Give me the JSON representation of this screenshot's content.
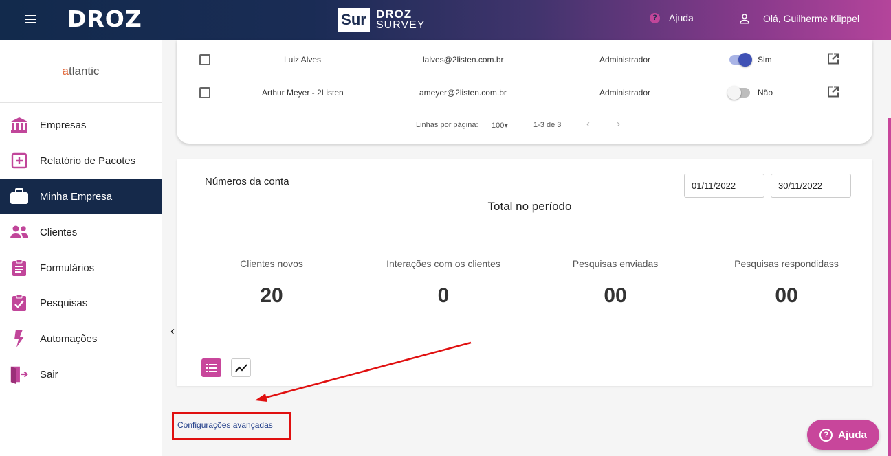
{
  "header": {
    "brand": "DROZ",
    "product_badge": "Sur",
    "product_line1": "DROZ",
    "product_line2": "SURVEY",
    "help_label": "Ajuda",
    "help_glyph": "?",
    "user_greeting": "Olá, Guilherme Klippel"
  },
  "sidebar": {
    "org_prefix": "a",
    "org_rest": "tlantic",
    "items": [
      {
        "label": "Empresas",
        "icon": "bank-icon"
      },
      {
        "label": "Relatório de Pacotes",
        "icon": "plus-box-icon"
      },
      {
        "label": "Minha Empresa",
        "icon": "briefcase-icon",
        "active": true
      },
      {
        "label": "Clientes",
        "icon": "users-icon"
      },
      {
        "label": "Formulários",
        "icon": "clipboard-list-icon"
      },
      {
        "label": "Pesquisas",
        "icon": "clipboard-check-icon"
      },
      {
        "label": "Automações",
        "icon": "lightning-icon"
      },
      {
        "label": "Sair",
        "icon": "exit-door-icon"
      }
    ]
  },
  "users_table": {
    "rows": [
      {
        "name": "Luiz Alves",
        "email": "lalves@2listen.com.br",
        "role": "Administrador",
        "active": true,
        "active_label": "Sim"
      },
      {
        "name": "Arthur Meyer - 2Listen",
        "email": "ameyer@2listen.com.br",
        "role": "Administrador",
        "active": false,
        "active_label": "Não"
      }
    ],
    "pagination": {
      "rows_per_page_label": "Linhas por página:",
      "rows_per_page": "100",
      "range": "1-3 de 3"
    }
  },
  "account_numbers": {
    "title": "Números da conta",
    "date_start": "01/11/2022",
    "date_end": "30/11/2022",
    "period_title": "Total no período",
    "metrics": [
      {
        "label": "Clientes novos",
        "value": "20"
      },
      {
        "label": "Interações com os clientes",
        "value": "0"
      },
      {
        "label": "Pesquisas enviadas",
        "value": "00"
      },
      {
        "label": "Pesquisas respondidass",
        "value": "00"
      }
    ]
  },
  "advanced_settings_link": "Configurações avançadas",
  "help_button": "Ajuda",
  "colors": {
    "header_start": "#122a4c",
    "header_end": "#b4449b",
    "accent": "#c8469b",
    "sidebar_active": "#15294a",
    "toggle_on": "#3f51b5",
    "annotation_red": "#e01010"
  }
}
